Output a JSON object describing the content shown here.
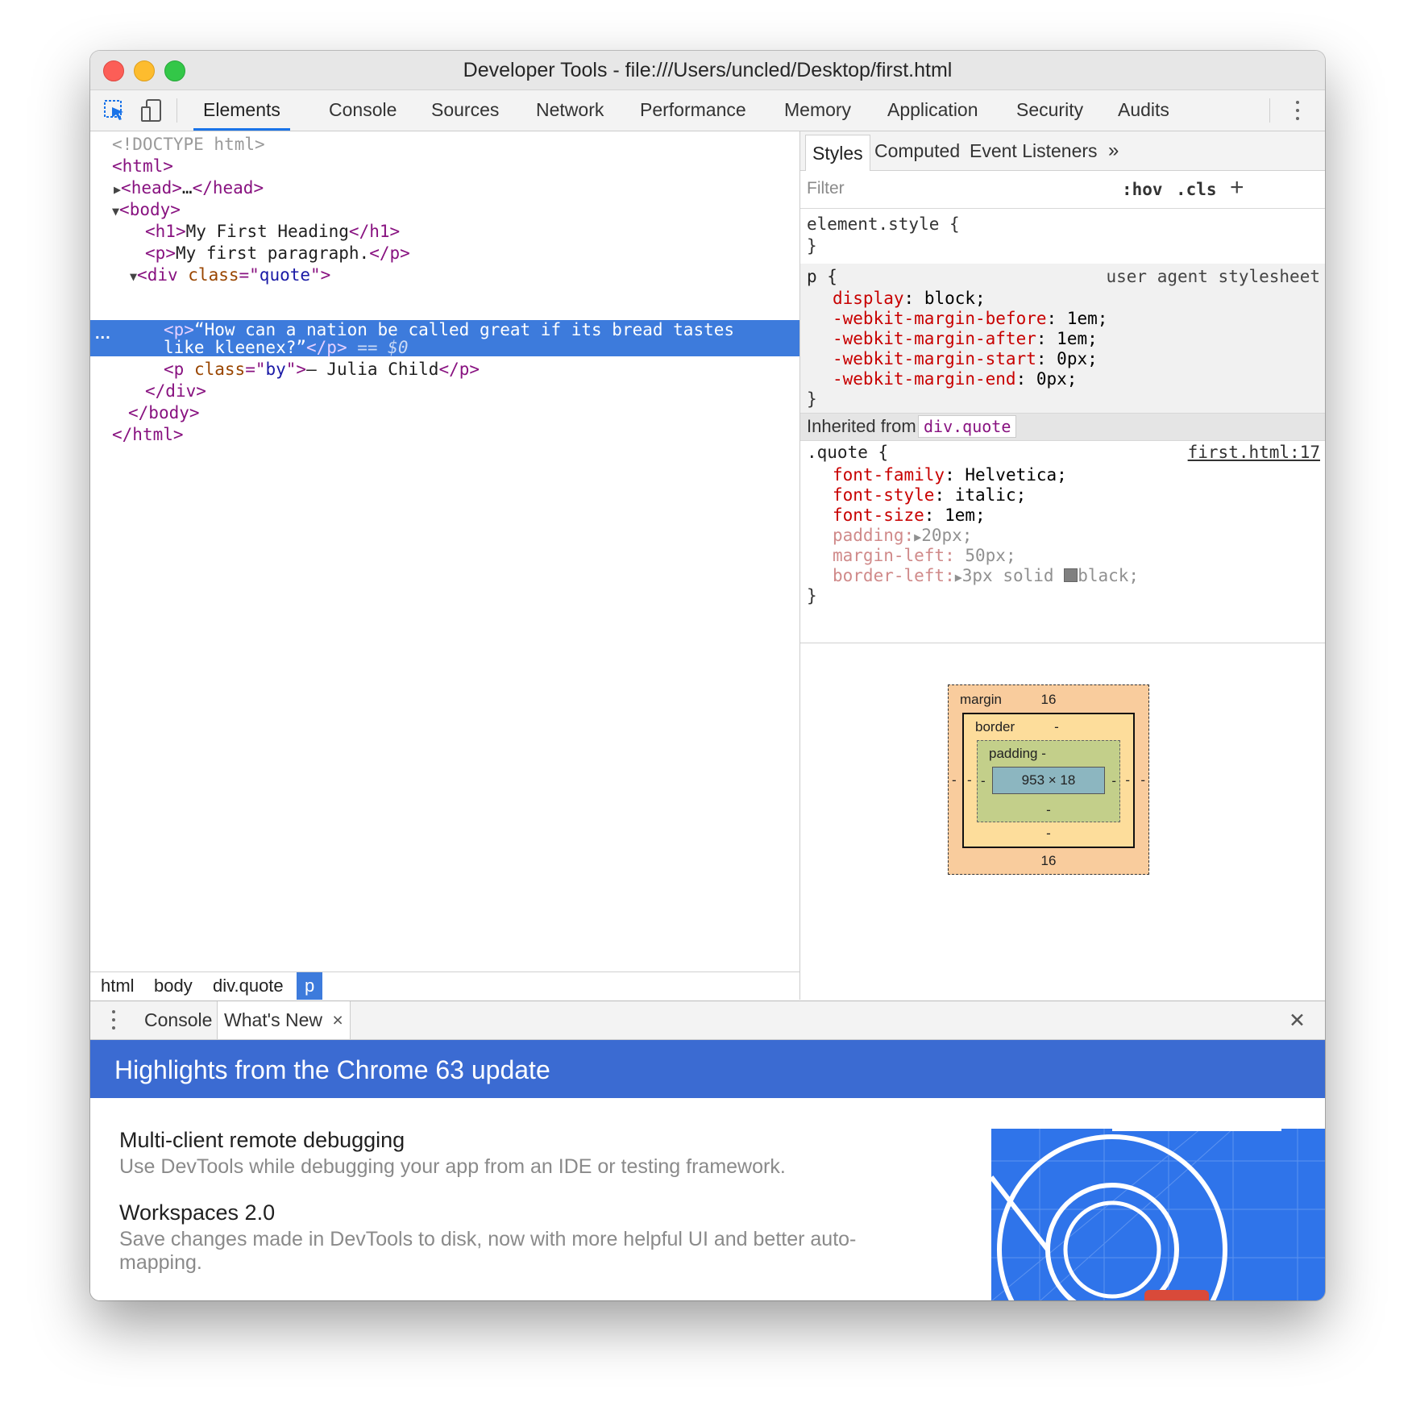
{
  "window": {
    "title": "Developer Tools - file:///Users/uncled/Desktop/first.html"
  },
  "toolbar": {
    "inspect_icon": "cursor-select-icon",
    "device_icon": "device-toggle-icon",
    "tabs": [
      "Elements",
      "Console",
      "Sources",
      "Network",
      "Performance",
      "Memory",
      "Application",
      "Security",
      "Audits"
    ],
    "active_tab": "Elements",
    "menu_icon": "kebab-menu-icon"
  },
  "dom": {
    "doctype": "<!DOCTYPE html>",
    "html_open": "html",
    "head_open": "head",
    "head_ellipsis": "…",
    "head_close": "/head",
    "body_open": "body",
    "h1_tag": "h1",
    "h1_text": "My First Heading",
    "h1_close": "/h1",
    "p_tag": "p",
    "p_text": "My first paragraph.",
    "p_close": "/p",
    "div_tag": "div",
    "div_attr": "class",
    "div_value": "quote",
    "sel_p_open": "<p>",
    "sel_line1": "“How can a nation be called great if its bread tastes",
    "sel_line2": "like kleenex?”",
    "sel_p_close": "</p>",
    "sel_marker": "== $0",
    "sel_dots": "...",
    "by_attr": "class",
    "by_value": "by",
    "by_text": "— Julia Child",
    "div_close": "/div",
    "body_close": "/body",
    "html_close": "/html"
  },
  "breadcrumbs": [
    "html",
    "body",
    "div.quote",
    "p"
  ],
  "styles": {
    "tabs": [
      "Styles",
      "Computed",
      "Event Listeners"
    ],
    "more_icon": "double-chevron-icon",
    "filter_placeholder": "Filter",
    "hov": ":hov",
    "cls": ".cls",
    "add": "+",
    "element_style_open": "element.style {",
    "close_brace": "}",
    "ua_selector": "p {",
    "ua_source": "user agent stylesheet",
    "ua_props": [
      {
        "name": "display",
        "value": "block;"
      },
      {
        "name": "-webkit-margin-before",
        "value": "1em;"
      },
      {
        "name": "-webkit-margin-after",
        "value": "1em;"
      },
      {
        "name": "-webkit-margin-start",
        "value": "0px;"
      },
      {
        "name": "-webkit-margin-end",
        "value": "0px;"
      }
    ],
    "inherited_label": "Inherited from",
    "inherited_selector": "div.quote",
    "quote_selector": ".quote {",
    "quote_source": "first.html:17",
    "quote_props": [
      {
        "name": "font-family",
        "value": "Helvetica;"
      },
      {
        "name": "font-style",
        "value": "italic;"
      },
      {
        "name": "font-size",
        "value": "1em;"
      }
    ],
    "quote_inactive_props": [
      {
        "name": "padding",
        "value": "20px;"
      },
      {
        "name": "margin-left",
        "value": "50px;"
      },
      {
        "name": "border-left",
        "value": "3px solid",
        "color_value": "black;"
      }
    ],
    "swatch_color": "#808080"
  },
  "box_model": {
    "margin_label": "margin",
    "margin_top": "16",
    "margin_bottom": "16",
    "margin_left": "-",
    "margin_right": "-",
    "border_label": "border",
    "border_top": "-",
    "border_bottom": "-",
    "border_left": "-",
    "border_right": "-",
    "padding_label": "padding -",
    "padding_bottom": "-",
    "padding_left": "-",
    "padding_right": "-",
    "content": "953 × 18"
  },
  "drawer": {
    "menu_icon": "kebab-menu-icon",
    "tabs": [
      "Console",
      "What's New"
    ],
    "close_tab_icon": "×",
    "close_icon": "close-icon",
    "close_glyph": "✕",
    "banner": "Highlights from the Chrome 63 update",
    "items": [
      {
        "title": "Multi-client remote debugging",
        "desc": "Use DevTools while debugging your app from an IDE or testing framework."
      },
      {
        "title": "Workspaces 2.0",
        "desc": "Save changes made in DevTools to disk, now with more helpful UI and better auto-mapping."
      }
    ]
  },
  "colors": {
    "accent": "#1a73e8",
    "selection": "#3d7bdc",
    "banner": "#3b6bd2",
    "tag": "#881280",
    "attr_name": "#994500",
    "attr_value": "#1a1aa6",
    "css_prop": "#c80000"
  }
}
